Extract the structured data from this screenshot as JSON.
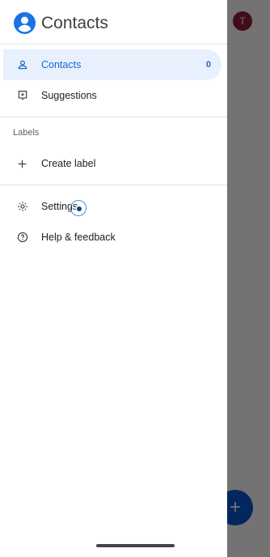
{
  "app": {
    "title": "Contacts",
    "brand_color": "#1a73e8"
  },
  "avatar": {
    "initial": "T",
    "color": "#8e1f3a"
  },
  "fab": {
    "label": "+"
  },
  "nav": {
    "contacts": {
      "label": "Contacts",
      "count": "0",
      "icon": "person-icon"
    },
    "suggestions": {
      "label": "Suggestions",
      "icon": "suggestions-icon"
    }
  },
  "labels": {
    "heading": "Labels",
    "create": {
      "label": "Create label",
      "icon": "plus-icon"
    }
  },
  "bottom": {
    "settings": {
      "label": "Settings",
      "icon": "gear-icon"
    },
    "help": {
      "label": "Help & feedback",
      "icon": "help-icon"
    }
  }
}
